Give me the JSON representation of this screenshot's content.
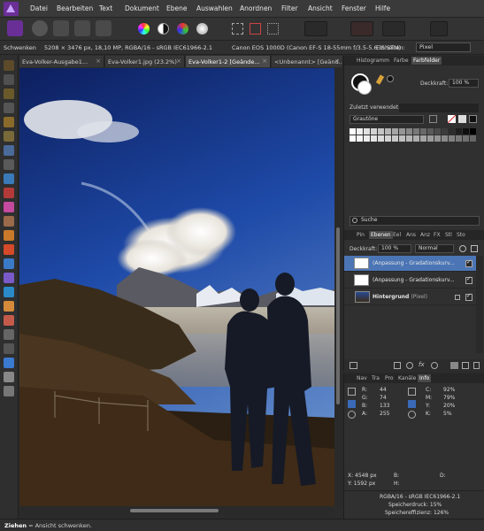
{
  "menu": [
    "Datei",
    "Bearbeiten",
    "Text",
    "Dokument",
    "Ebene",
    "Auswahlen",
    "Anordnen",
    "Filter",
    "Ansicht",
    "Fenster",
    "Hilfe"
  ],
  "context": {
    "tool": "Schwenken",
    "image_info": "5208 × 3476 px, 18,10 MP, RGBA/16 - sRGB IEC61966-2.1",
    "camera": "Canon EOS 1000D (Canon EF-S 18-55mm f/3.5-5.6 IS STM)",
    "units_label": "Einheiten:",
    "units_value": "Pixel"
  },
  "doc_tabs": [
    {
      "label": "Eva-Volker-Ausgabe1...",
      "close": "×"
    },
    {
      "label": "Eva-Volker1.jpg (23.2%)",
      "close": "×"
    },
    {
      "label": "Eva-Volker1-2 [Geände...",
      "close": "×"
    },
    {
      "label": "<Unbenannt> [Geänd...",
      "close": "×"
    }
  ],
  "color_panel": {
    "tabs": [
      "Histogramm",
      "Farbe",
      "Farbfelder"
    ],
    "opacity_label": "Deckkraft:",
    "opacity_value": "100 %",
    "recent_label": "Zuletzt verwendet:",
    "palette_select": "Grautöne"
  },
  "layers_panel": {
    "search_placeholder": "Suche",
    "tabs": [
      "Pin",
      "Ebenen",
      "Eel",
      "Ans",
      "Anz",
      "FX",
      "Stl",
      "Sto"
    ],
    "opacity_label": "Deckkraft:",
    "opacity_value": "100 %",
    "blend_mode": "Normal",
    "layers": [
      {
        "name": "(Anpassung - Gradationskurv...",
        "selected": true
      },
      {
        "name": "(Anpassung - Gradationskurv...",
        "selected": false
      },
      {
        "name": "Hintergrund",
        "suffix": "(Pixel)",
        "selected": false
      }
    ]
  },
  "info_panel": {
    "tabs": [
      "Nav",
      "Tra",
      "Pro",
      "Kanäle",
      "Info"
    ],
    "rgb": {
      "R": "44",
      "G": "74",
      "B": "133",
      "A": "255"
    },
    "cmyk": {
      "C": "92%",
      "M": "79%",
      "Y": "20%",
      "K": "5%"
    },
    "labels": {
      "R": "R:",
      "G": "G:",
      "B": "B:",
      "A": "A:",
      "C": "C:",
      "M": "M:",
      "Y": "Y:",
      "K": "K:"
    },
    "x_text": "X: 4548 px",
    "y_text": "Y: 1592 px",
    "b_label": "B:",
    "h_label": "H:",
    "d_label": "D:",
    "profile": "RGBA/16 - sRGB IEC61966-2.1",
    "memory_pressure": "Speicherdruck: 15%",
    "memory_efficiency": "Speichereffizienz: 126%"
  },
  "status": {
    "bold": "Ziehen",
    "text": " = Ansicht schwenken."
  },
  "colors": {
    "accent": "#4b75b5",
    "app_logo": "#6a2f97",
    "background": "#2b2b2b"
  }
}
